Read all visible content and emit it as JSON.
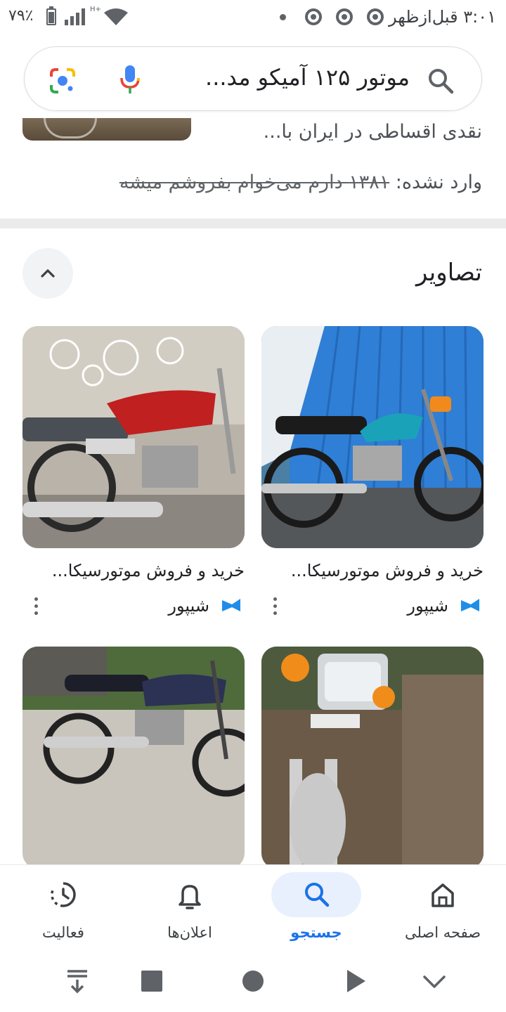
{
  "status_bar": {
    "time": "۳:۰۱ قبل‌ازظهر",
    "battery": "۷۹٪",
    "network": "H+"
  },
  "search": {
    "query": "موتور ۱۲۵ آمیکو مد...",
    "icons": [
      "search-icon",
      "mic-icon",
      "google-lens-icon"
    ]
  },
  "previous_result": {
    "snippet": "نقدی اقساطی در ایران با...",
    "missing_label": "وارد نشده:",
    "missing_terms": "۱۳۸۱ دارم می‌خوام بفروشم میشه"
  },
  "images_section": {
    "title": "تصاویر",
    "items": [
      {
        "caption": "خرید و فروش موتورسیکا...",
        "source": "شیپور"
      },
      {
        "caption": "خرید و فروش موتورسیکا...",
        "source": "شیپور"
      },
      {
        "caption": "",
        "source": ""
      },
      {
        "caption": "",
        "source": ""
      }
    ]
  },
  "bottom_nav": {
    "items": [
      {
        "label": "صفحه اصلی",
        "icon": "home-icon"
      },
      {
        "label": "جستجو",
        "icon": "search-icon",
        "active": true
      },
      {
        "label": "اعلان‌ها",
        "icon": "bell-icon"
      },
      {
        "label": "فعالیت",
        "icon": "activity-icon"
      }
    ]
  },
  "colors": {
    "accent": "#1a73e8",
    "active_pill": "#e8f0fe",
    "divider": "#ebebeb"
  }
}
